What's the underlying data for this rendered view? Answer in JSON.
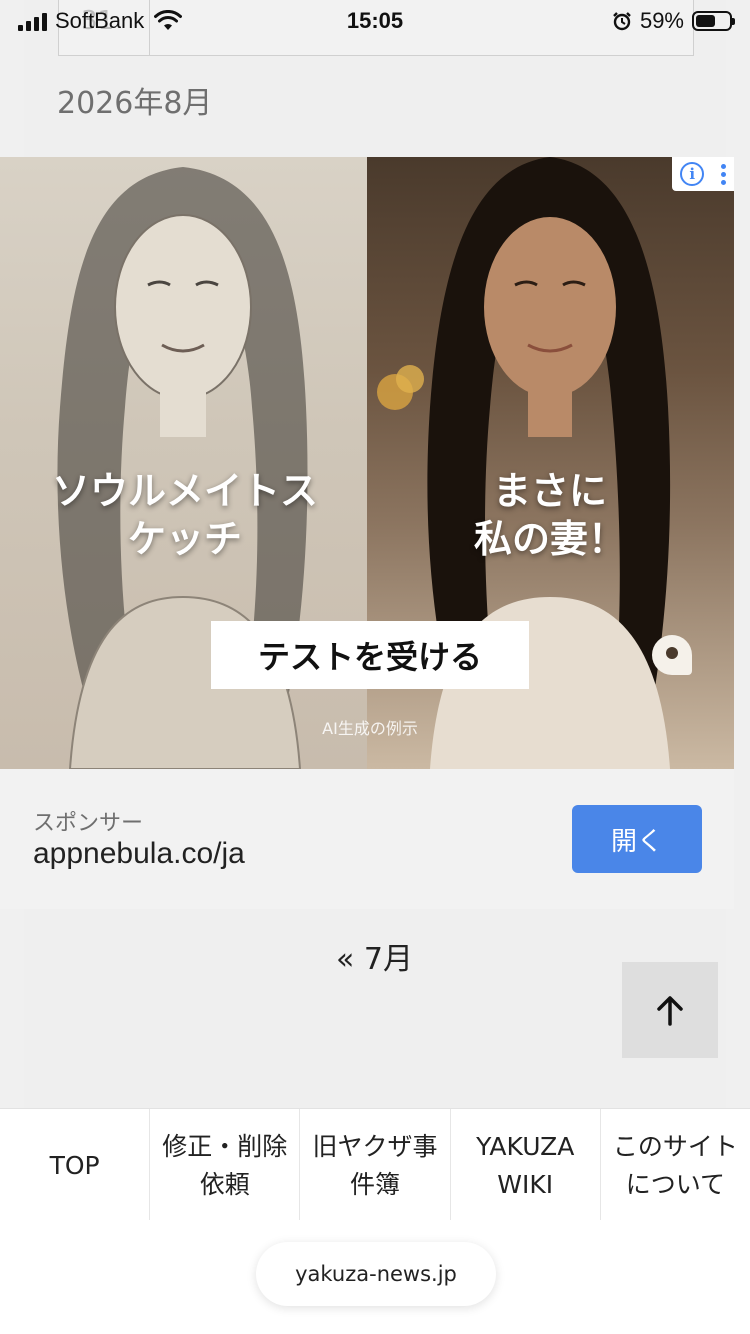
{
  "status_bar": {
    "carrier": "SoftBank",
    "time": "15:05",
    "battery_percent": "59%",
    "battery_level": 0.59,
    "icons": [
      "signal-icon",
      "wifi-icon",
      "alarm-icon",
      "battery-icon"
    ]
  },
  "calendar": {
    "previous_cell_number": "31",
    "month_title": "2026年8月",
    "prev_month_link": "« 7月"
  },
  "ad": {
    "left_text": "ソウルメイトス\nケッチ",
    "right_text": "まさに\n私の妻！",
    "cta": "テストを受ける",
    "caption": "AI生成の例示",
    "badge_icons": [
      "info-icon",
      "more-options-icon"
    ]
  },
  "sponsor": {
    "label": "スポンサー",
    "url": "appnebula.co/ja",
    "open_button": "開く"
  },
  "scroll_top_icon": "arrow-up-icon",
  "bottom_nav": {
    "items": [
      {
        "label": "TOP"
      },
      {
        "label": "修正・削除\n依頼"
      },
      {
        "label": "旧ヤクザ事\n件簿"
      },
      {
        "label": "YAKUZA\nWIKI"
      },
      {
        "label": "このサイト\nについて"
      }
    ]
  },
  "browser": {
    "url": "yakuza-news.jp"
  }
}
